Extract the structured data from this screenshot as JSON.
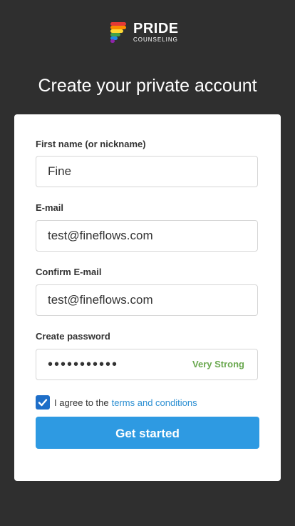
{
  "brand": {
    "name": "PRIDE",
    "tagline": "COUNSELING",
    "logo_icon": "pride-rainbow-icon"
  },
  "headline": "Create your private account",
  "form": {
    "first_name": {
      "label": "First name (or nickname)",
      "value": "Fine"
    },
    "email": {
      "label": "E-mail",
      "value": "test@fineflows.com"
    },
    "confirm_email": {
      "label": "Confirm E-mail",
      "value": "test@fineflows.com"
    },
    "password": {
      "label": "Create password",
      "masked_value": "•••••••••••",
      "strength": "Very Strong"
    },
    "agree": {
      "checked": true,
      "text": "I agree to the",
      "link_text": "terms and conditions"
    },
    "submit_label": "Get started"
  },
  "colors": {
    "background": "#2f2f2f",
    "card": "#ffffff",
    "primary_button": "#2e9ae2",
    "link": "#2a8ed2",
    "strength": "#6aa84f",
    "checkbox": "#1e6ec8"
  }
}
